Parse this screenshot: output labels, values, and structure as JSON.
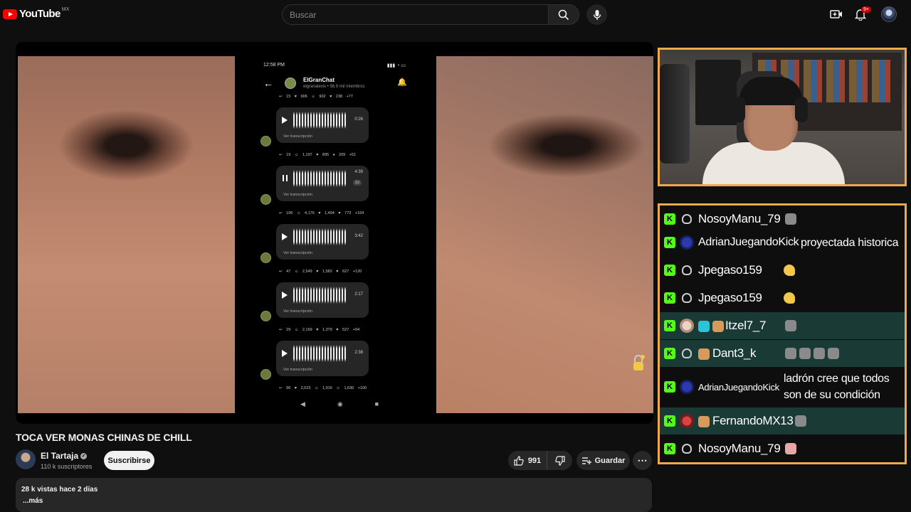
{
  "header": {
    "logo_text": "YouTube",
    "region": "MX",
    "search_placeholder": "Buscar",
    "notification_count": "9+"
  },
  "player": {
    "phone": {
      "time": "12:58 PM",
      "group_name": "ElGranChat",
      "group_sub": "elgranalexis • 56.9 mil miembros",
      "reactions": [
        "↩ 15   ♥ 906   ☺ 902   ♥ 238   +77",
        "↩ 19   ☺ 1,197   ♥ 895   ♦ 209   +51",
        "↩ 106   ☺ 4,176   ♥ 1,494   ♥ 773   +164",
        "↩ 47   ☺ 2,549   ♥ 1,582   ♥ 627   +120",
        "↩ 29   ☺ 2,169   ♥ 1,379   ♥ 527   +94",
        "↩ 96   ♥ 2,523   ☺ 1,916   ☺ 1,636   +100"
      ],
      "voice_messages": [
        {
          "duration": "0:26",
          "transcript_label": "Ver transcripción"
        },
        {
          "duration": "4:39",
          "speed": "1x",
          "transcript_label": "Ver transcripción"
        },
        {
          "duration": "3:42",
          "transcript_label": "Ver transcripción"
        },
        {
          "duration": "2:17",
          "transcript_label": "Ver transcripción"
        },
        {
          "duration": "2:38",
          "transcript_label": "Ver transcripción"
        }
      ]
    }
  },
  "chat": {
    "messages": [
      {
        "user": "NosoyManu_79",
        "text": ""
      },
      {
        "user": "AdrianJuegandoKick",
        "text": "proyectada historica"
      },
      {
        "user": "Jpegaso159",
        "text": ""
      },
      {
        "user": "Jpegaso159",
        "text": ""
      },
      {
        "user": "Itzel7_7",
        "text": ""
      },
      {
        "user": "Dant3_k",
        "text": ""
      },
      {
        "user": "AdrianJuegandoKick",
        "text": "ladrón cree que todos",
        "text2": "son de su condición"
      },
      {
        "user": "FernandoMX13",
        "text": ""
      },
      {
        "user": "NosoyManu_79",
        "text": ""
      }
    ]
  },
  "video": {
    "title": "TOCA VER MONAS CHINAS DE CHILL",
    "channel": "El Tartaja",
    "subscribers": "110 k suscriptores",
    "subscribe_label": "Suscribirse",
    "likes": "991",
    "save_label": "Guardar",
    "views_date": "28 k vistas  hace 2 días",
    "more_label": "...más"
  },
  "colors": {
    "overlay_border": "#f0a84c",
    "kick_green": "#53fc18",
    "highlight_row": "#1a3a36"
  }
}
